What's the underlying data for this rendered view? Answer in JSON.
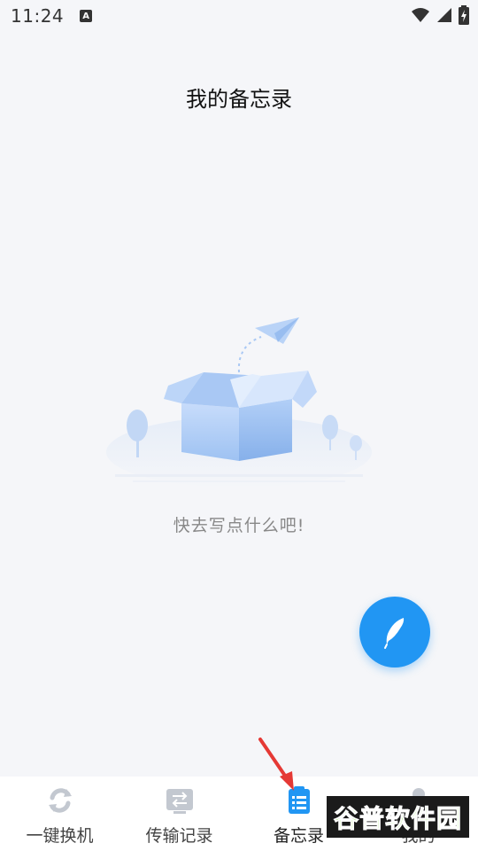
{
  "status_bar": {
    "time": "11:24",
    "notification_icon": "a-icon",
    "icons": [
      "wifi-icon",
      "signal-icon",
      "battery-charging-icon"
    ]
  },
  "page": {
    "title": "我的备忘录",
    "empty_text": "快去写点什么吧!"
  },
  "fab": {
    "icon": "feather-icon",
    "color": "#2196f3"
  },
  "tabs": [
    {
      "label": "一键换机",
      "icon": "swap-icon",
      "active": false
    },
    {
      "label": "传输记录",
      "icon": "transfer-icon",
      "active": false
    },
    {
      "label": "备忘录",
      "icon": "notes-icon",
      "active": true
    },
    {
      "label": "我的",
      "icon": "profile-icon",
      "active": false
    }
  ],
  "watermark": {
    "text": "谷普软件园"
  },
  "colors": {
    "accent": "#2196f3",
    "background": "#f5f6f9"
  }
}
